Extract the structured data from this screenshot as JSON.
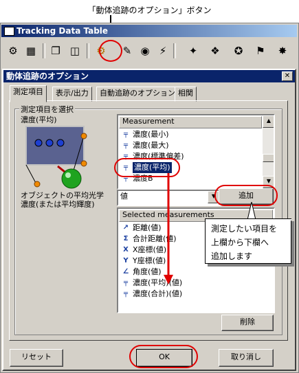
{
  "caption": "「動体追跡のオプション」ボタン",
  "main_window": {
    "title": "Tracking Data Table"
  },
  "toolbar": {
    "buttons": [
      {
        "icon": "chart-settings-icon",
        "glyph": "⚙"
      },
      {
        "icon": "table-icon",
        "glyph": "▦"
      },
      {
        "icon": "copy-icon",
        "glyph": "❐"
      },
      {
        "icon": "window-icon",
        "glyph": "◫"
      },
      {
        "icon": "tracking-options-icon",
        "glyph": "⚙"
      },
      {
        "icon": "tracking-icon-2",
        "glyph": "✎"
      },
      {
        "icon": "tracking-icon-3",
        "glyph": "◉"
      },
      {
        "icon": "tracking-icon-4",
        "glyph": "⚡"
      },
      {
        "icon": "tracking-icon-5",
        "glyph": "✦"
      },
      {
        "icon": "tracking-icon-6",
        "glyph": "❖"
      },
      {
        "icon": "tracking-icon-7",
        "glyph": "✪"
      },
      {
        "icon": "tracking-icon-8",
        "glyph": "⚑"
      },
      {
        "icon": "tracking-icon-9",
        "glyph": "✸"
      }
    ]
  },
  "dialog": {
    "title": "動体追跡のオプション",
    "close": "✕",
    "tabs": [
      "測定項目",
      "表示/出力",
      "自動追跡のオプション",
      "相関"
    ],
    "group_label": "測定項目を選択",
    "preview_label": "濃度(平均)",
    "preview_desc_line1": "オブジェクトの平均光学",
    "preview_desc_line2": "濃度(または平均輝度)",
    "measurement_list": {
      "header": "Measurement",
      "items": [
        "濃度(最小)",
        "濃度(最大)",
        "濃度(標準偏差)",
        "濃度(平均)",
        "濃度B"
      ],
      "selected_index": 3
    },
    "value_combo": "値",
    "add_button": "追加",
    "selected_list": {
      "header": "Selected measurements",
      "items": [
        {
          "icon": "distance-icon",
          "glyph": "↗",
          "label": "距離(値)"
        },
        {
          "icon": "total-distance-icon",
          "glyph": "Σ",
          "label": "合計距離(値)"
        },
        {
          "icon": "x-coordinate-icon",
          "glyph": "X",
          "label": "X座標(値)"
        },
        {
          "icon": "y-coordinate-icon",
          "glyph": "Y",
          "label": "Y座標(値)"
        },
        {
          "icon": "angle-icon",
          "glyph": "∠",
          "label": "角度(値)"
        },
        {
          "icon": "density-icon",
          "glyph": "╤",
          "label": "濃度(平均)(値)"
        },
        {
          "icon": "density-icon",
          "glyph": "╤",
          "label": "濃度(合計)(値)"
        }
      ]
    },
    "delete_button": "削除",
    "reset_button": "リセット",
    "ok_button": "OK",
    "cancel_button": "取り消し"
  },
  "callout": {
    "line1": "測定したい項目を",
    "line2": "上欄から下欄へ",
    "line3": "追加します"
  },
  "colors": {
    "annotation": "#e00000",
    "selection": "#0a246a",
    "title_bar": "#0a246a"
  }
}
